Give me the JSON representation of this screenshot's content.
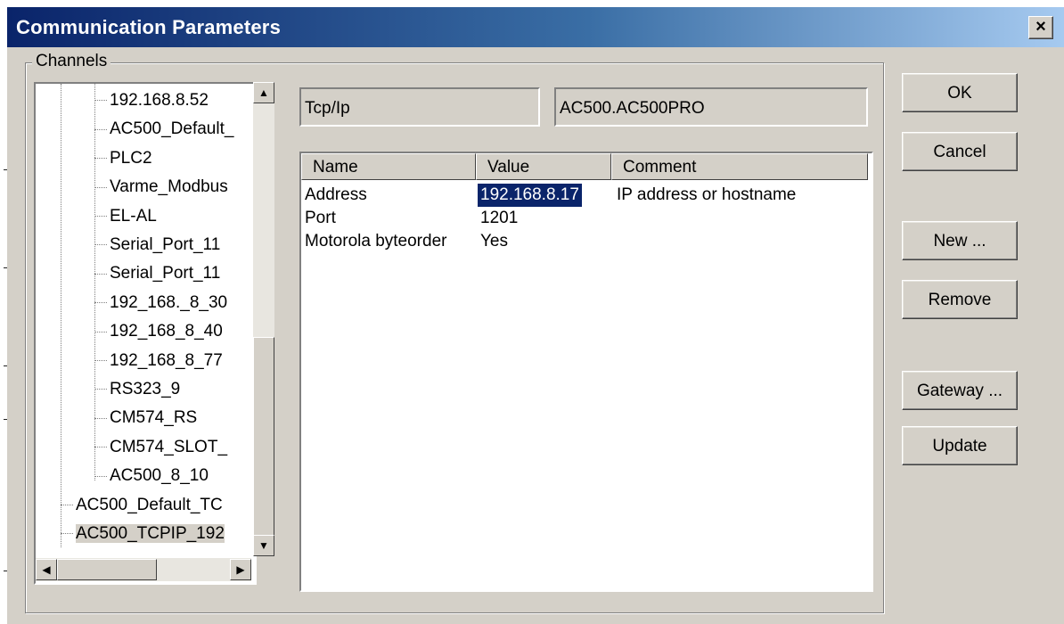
{
  "window": {
    "title": "Communication Parameters",
    "close_glyph": "×"
  },
  "channels": {
    "group_label": "Channels",
    "items": [
      "192.168.8.52",
      "AC500_Default_",
      "PLC2",
      "Varme_Modbus",
      "EL-AL",
      "Serial_Port_11",
      "Serial_Port_11",
      "192_168._8_30",
      "192_168_8_40",
      "192_168_8_77",
      "RS323_9",
      "CM574_RS",
      "CM574_SLOT_",
      "AC500_8_10",
      "AC500_Default_TC",
      "AC500_TCPIP_192"
    ],
    "selected_index": 15
  },
  "driver": {
    "protocol": "Tcp/Ip",
    "target": "AC500.AC500PRO"
  },
  "properties": {
    "columns": [
      "Name",
      "Value",
      "Comment"
    ],
    "rows": [
      {
        "name": "Address",
        "value": "192.168.8.17",
        "comment": "IP address or hostname"
      },
      {
        "name": "Port",
        "value": "1201",
        "comment": ""
      },
      {
        "name": "Motorola byteorder",
        "value": "Yes",
        "comment": ""
      }
    ]
  },
  "buttons": {
    "ok": "OK",
    "cancel": "Cancel",
    "new": "New ...",
    "remove": "Remove",
    "gateway": "Gateway ...",
    "update": "Update"
  },
  "icons": {
    "scroll_up": "▲",
    "scroll_down": "▼",
    "scroll_left": "◀",
    "scroll_right": "▶"
  }
}
